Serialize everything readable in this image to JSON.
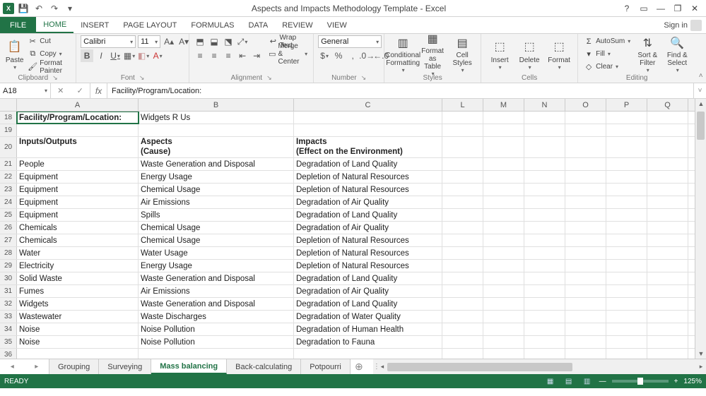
{
  "title": "Aspects and Impacts Methodology Template - Excel",
  "signin": "Sign in",
  "ribbon_tabs": [
    "FILE",
    "HOME",
    "INSERT",
    "PAGE LAYOUT",
    "FORMULAS",
    "DATA",
    "REVIEW",
    "VIEW"
  ],
  "name_box": "A18",
  "formula": "Facility/Program/Location:",
  "clipboard": {
    "label": "Clipboard",
    "paste": "Paste",
    "cut": "Cut",
    "copy": "Copy",
    "format_painter": "Format Painter"
  },
  "font": {
    "label": "Font",
    "name": "Calibri",
    "size": "11"
  },
  "alignment": {
    "label": "Alignment",
    "wrap": "Wrap Text",
    "merge": "Merge & Center"
  },
  "number": {
    "label": "Number",
    "format": "General"
  },
  "styles": {
    "label": "Styles",
    "conditional": "Conditional\nFormatting",
    "format_as_table": "Format as\nTable",
    "cell_styles": "Cell\nStyles"
  },
  "cells": {
    "label": "Cells",
    "insert": "Insert",
    "delete": "Delete",
    "format": "Format"
  },
  "editing": {
    "label": "Editing",
    "autosum": "AutoSum",
    "fill": "Fill",
    "clear": "Clear",
    "sort": "Sort &\nFilter",
    "find": "Find &\nSelect"
  },
  "columns_shown": [
    "A",
    "B",
    "C",
    "L",
    "M",
    "N",
    "O",
    "P",
    "Q"
  ],
  "row_start": 18,
  "row_end": 36,
  "cells_data": {
    "18": {
      "A": "Facility/Program/Location:",
      "B": "Widgets R Us"
    },
    "19": {},
    "20": {
      "A": "Inputs/Outputs",
      "B": "Aspects\n(Cause)",
      "C": "Impacts\n(Effect on the Environment)"
    },
    "21": {
      "A": "People",
      "B": "Waste Generation and Disposal",
      "C": "Degradation of Land Quality"
    },
    "22": {
      "A": "Equipment",
      "B": "Energy Usage",
      "C": "Depletion of Natural Resources"
    },
    "23": {
      "A": "Equipment",
      "B": "Chemical Usage",
      "C": "Depletion of Natural Resources"
    },
    "24": {
      "A": "Equipment",
      "B": "Air Emissions",
      "C": "Degradation of Air Quality"
    },
    "25": {
      "A": "Equipment",
      "B": "Spills",
      "C": "Degradation of Land Quality"
    },
    "26": {
      "A": "Chemicals",
      "B": "Chemical Usage",
      "C": "Degradation of Air Quality"
    },
    "27": {
      "A": "Chemicals",
      "B": "Chemical Usage",
      "C": "Depletion of Natural Resources"
    },
    "28": {
      "A": "Water",
      "B": "Water Usage",
      "C": "Depletion of Natural Resources"
    },
    "29": {
      "A": "Electricity",
      "B": "Energy Usage",
      "C": "Depletion of Natural Resources"
    },
    "30": {
      "A": "Solid Waste",
      "B": "Waste Generation and Disposal",
      "C": "Degradation of Land Quality"
    },
    "31": {
      "A": "Fumes",
      "B": "Air Emissions",
      "C": "Degradation of Air Quality"
    },
    "32": {
      "A": "Widgets",
      "B": "Waste Generation and Disposal",
      "C": "Degradation of Land Quality"
    },
    "33": {
      "A": "Wastewater",
      "B": "Waste Discharges",
      "C": "Degradation of Water Quality"
    },
    "34": {
      "A": "Noise",
      "B": "Noise Pollution",
      "C": "Degradation of Human Health"
    },
    "35": {
      "A": "Noise",
      "B": "Noise Pollution",
      "C": "Degradation to Fauna"
    },
    "36": {}
  },
  "sheet_tabs": [
    "Grouping",
    "Surveying",
    "Mass balancing",
    "Back-calculating",
    "Potpourri"
  ],
  "active_sheet": "Mass balancing",
  "status": "READY",
  "zoom": "125%"
}
